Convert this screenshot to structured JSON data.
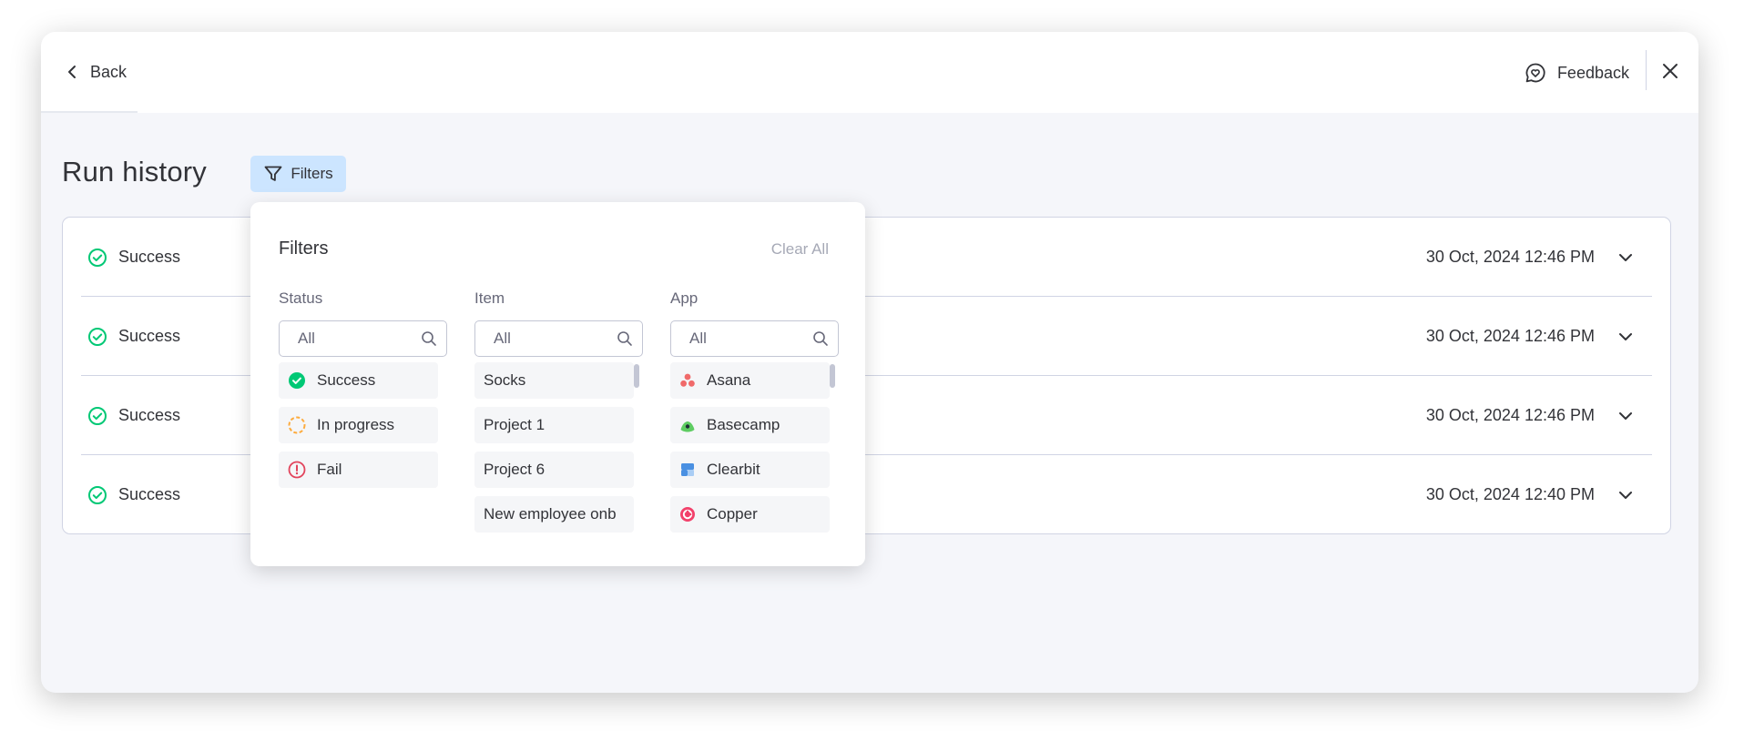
{
  "header": {
    "back_label": "Back",
    "feedback_label": "Feedback"
  },
  "page": {
    "title": "Run history",
    "filters_button": "Filters"
  },
  "runs": [
    {
      "status": "Success",
      "date": "30 Oct, 2024 12:46 PM"
    },
    {
      "status": "Success",
      "date": "30 Oct, 2024 12:46 PM"
    },
    {
      "status": "Success",
      "date": "30 Oct, 2024 12:46 PM"
    },
    {
      "status": "Success",
      "date": "30 Oct, 2024 12:40 PM"
    }
  ],
  "filter_panel": {
    "title": "Filters",
    "clear_all": "Clear All",
    "columns": {
      "status": {
        "label": "Status",
        "placeholder": "All",
        "options": [
          {
            "label": "Success",
            "icon": "success-check-icon",
            "color": "#00c875"
          },
          {
            "label": "In progress",
            "icon": "in-progress-icon",
            "color": "#fdab3d"
          },
          {
            "label": "Fail",
            "icon": "fail-alert-icon",
            "color": "#e2445c"
          }
        ]
      },
      "item": {
        "label": "Item",
        "placeholder": "All",
        "options": [
          {
            "label": "Socks"
          },
          {
            "label": "Project 1"
          },
          {
            "label": "Project 6"
          },
          {
            "label": "New employee onb"
          }
        ]
      },
      "app": {
        "label": "App",
        "placeholder": "All",
        "options": [
          {
            "label": "Asana",
            "icon": "asana-icon",
            "color": "#f06a6a"
          },
          {
            "label": "Basecamp",
            "icon": "basecamp-icon",
            "color": "#5ecc62"
          },
          {
            "label": "Clearbit",
            "icon": "clearbit-icon",
            "color": "#4a90e2"
          },
          {
            "label": "Copper",
            "icon": "copper-icon",
            "color": "#f2416b"
          }
        ]
      }
    }
  },
  "colors": {
    "success": "#00c875",
    "filters_active_bg": "#cce5ff",
    "modal_bg": "#f5f6fa"
  }
}
